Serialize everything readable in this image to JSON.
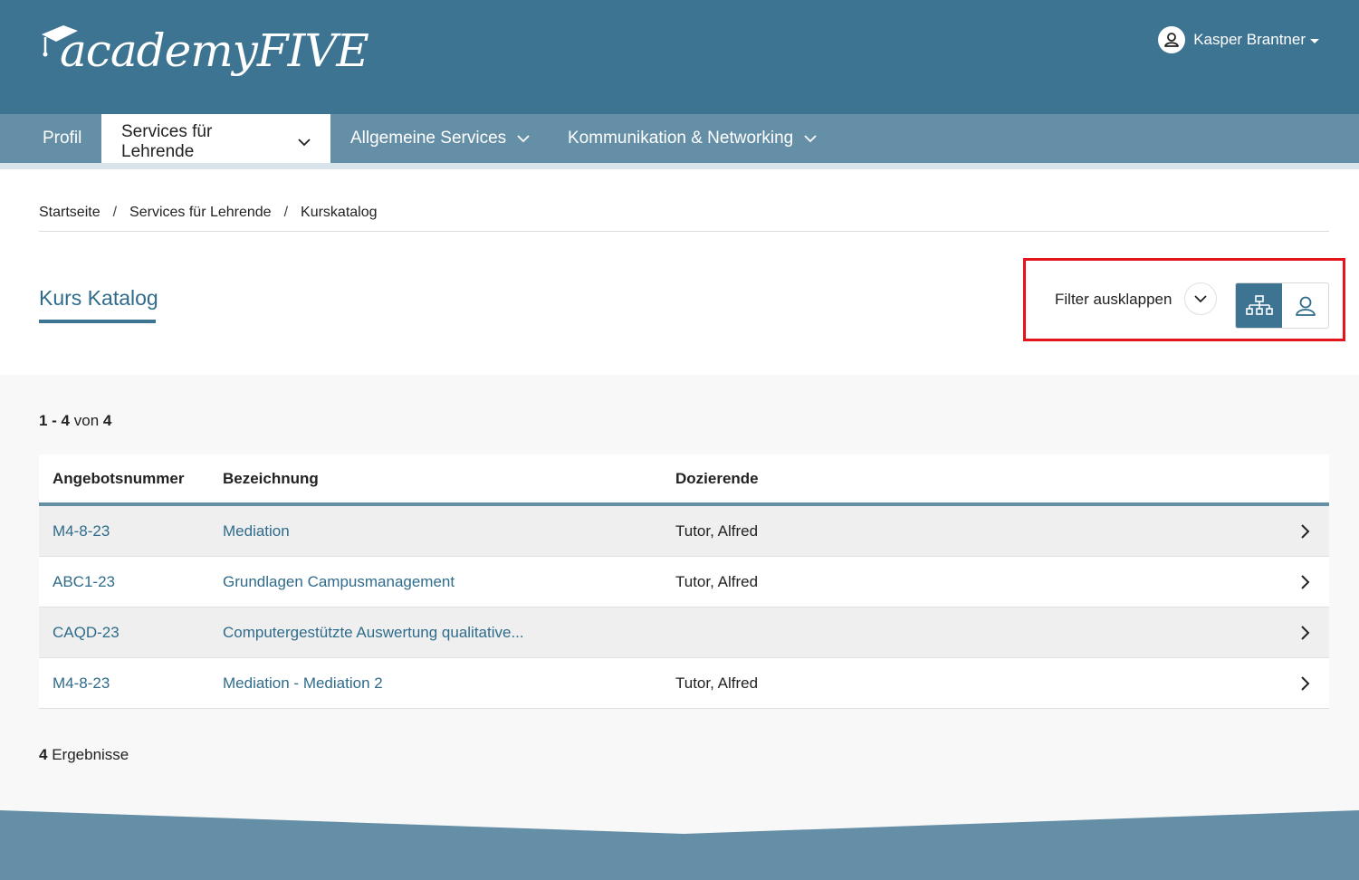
{
  "header": {
    "logo_text": "academyFIVE",
    "user_name": "Kasper Brantner"
  },
  "nav": {
    "items": [
      {
        "label": "Profil"
      },
      {
        "label": "Services für Lehrende"
      },
      {
        "label": "Allgemeine Services"
      },
      {
        "label": "Kommunikation & Networking"
      }
    ]
  },
  "breadcrumb": {
    "items": [
      "Startseite",
      "Services für Lehrende",
      "Kurskatalog"
    ],
    "separator": "/"
  },
  "page": {
    "title": "Kurs Katalog",
    "filter_label": "Filter ausklappen"
  },
  "list": {
    "range": "1 - 4",
    "von": "von",
    "total": "4",
    "columns": [
      "Angebotsnummer",
      "Bezeichnung",
      "Dozierende"
    ],
    "rows": [
      {
        "nummer": "M4-8-23",
        "bezeichnung": "Mediation",
        "dozierende": "Tutor, Alfred"
      },
      {
        "nummer": "ABC1-23",
        "bezeichnung": "Grundlagen Campusmanagement",
        "dozierende": "Tutor, Alfred"
      },
      {
        "nummer": "CAQD-23",
        "bezeichnung": "Computergestützte Auswertung qualitative...",
        "dozierende": ""
      },
      {
        "nummer": "M4-8-23",
        "bezeichnung": "Mediation - Mediation 2",
        "dozierende": "Tutor, Alfred"
      }
    ],
    "results_count": "4",
    "results_label": "Ergebnisse"
  },
  "icons": {
    "user": "user-icon",
    "hierarchy": "sitemap-icon",
    "person": "person-icon",
    "chevron_down": "chevron-down-icon",
    "chevron_right": "chevron-right-icon"
  },
  "colors": {
    "header": "#3d7491",
    "nav": "#658fa6",
    "accent": "#2f6c8c",
    "highlight": "#e3141c"
  }
}
